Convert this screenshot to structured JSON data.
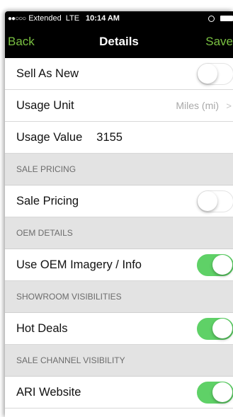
{
  "status_bar": {
    "signal_dots": "●●○○○",
    "carrier": "Extended",
    "network": "LTE",
    "time": "10:14 AM",
    "alarm_icon": "alarm-clock-icon",
    "battery_icon": "battery-icon"
  },
  "nav": {
    "back_label": "Back",
    "title": "Details",
    "save_label": "Save",
    "accent_color": "#7ac142"
  },
  "rows": {
    "sell_as_new": {
      "label": "Sell As New",
      "toggle_on": false
    },
    "usage_unit": {
      "label": "Usage Unit",
      "value": "Miles (mi)",
      "chevron": ">"
    },
    "usage_value": {
      "label": "Usage Value",
      "value": "3155"
    },
    "sale_pricing_header": "SALE PRICING",
    "sale_pricing": {
      "label": "Sale Pricing",
      "toggle_on": false
    },
    "oem_header": "OEM DETAILS",
    "use_oem": {
      "label": "Use OEM Imagery / Info",
      "toggle_on": true
    },
    "showroom_header": "SHOWROOM VISIBILITIES",
    "hot_deals": {
      "label": "Hot Deals",
      "toggle_on": true
    },
    "sale_channel_header": "SALE CHANNEL VISIBILITY",
    "ari_website": {
      "label": "ARI Website",
      "toggle_on": true
    }
  },
  "colors": {
    "toggle_on": "#5fd167",
    "section_bg": "#e3e3e3"
  }
}
